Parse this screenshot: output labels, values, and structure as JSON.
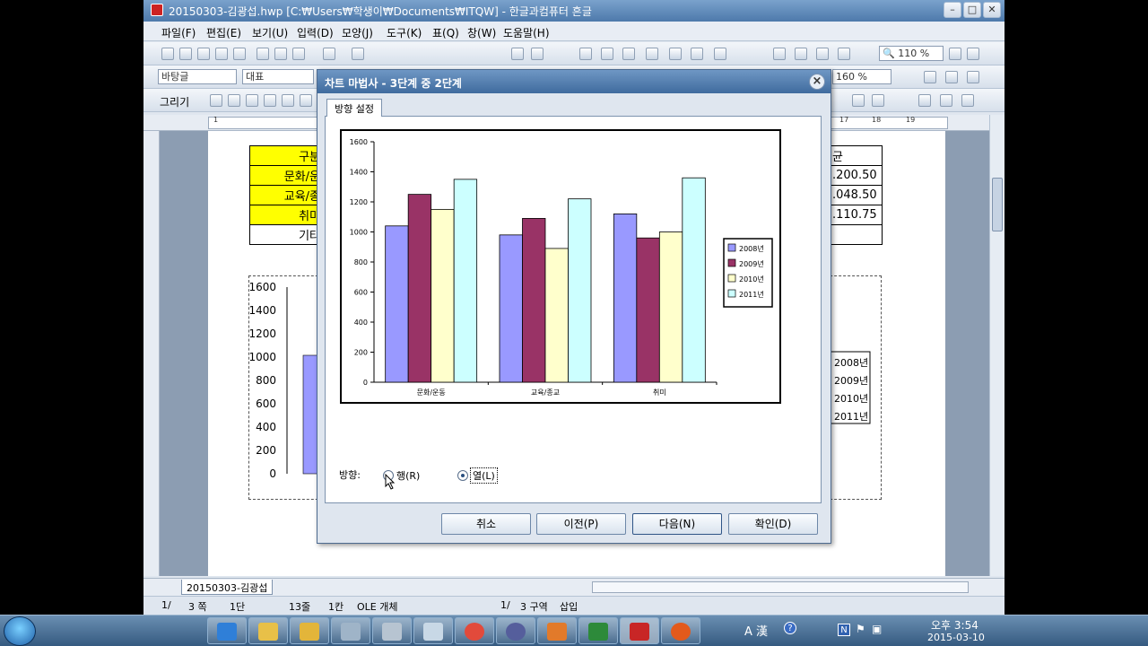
{
  "window": {
    "title": "20150303-김광섭.hwp [C:₩Users₩학생이₩Documents₩ITQW] - 한글과컴퓨터 흔글"
  },
  "menu": [
    "파일(F)",
    "편집(E)",
    "보기(U)",
    "입력(D)",
    "모양(J)",
    "도구(K)",
    "표(Q)",
    "창(W)",
    "도움말(H)"
  ],
  "toolbar": {
    "zoom": "110 %",
    "style": "바탕글",
    "font_group": "대표",
    "zoom2": "160 %",
    "draw_label": "그리기"
  },
  "ruler_numbers": [
    "1",
    "17",
    "18",
    "19"
  ],
  "doc": {
    "left_table": [
      "구분",
      "문화/운",
      "교육/종",
      "취미",
      "기타"
    ],
    "right_table": [
      "균",
      ".200.50",
      ".048.50",
      ".110.75"
    ],
    "chart_y_ticks": [
      "1600",
      "1400",
      "1200",
      "1000",
      "800",
      "600",
      "400",
      "200",
      "0"
    ],
    "chart_legend": [
      "2008년",
      "2009년",
      "2010년",
      "2011년"
    ]
  },
  "doc_tab": "20150303-김광섭",
  "status": {
    "page": "1/",
    "sheet": "3 쪽",
    "col": "1단",
    "line": "13줄",
    "char": "1칸",
    "object": "OLE 개체",
    "sec_page": "1/",
    "section": "3 구역",
    "insert": "삽입"
  },
  "dialog": {
    "title": "차트 마법사 - 3단계 중 2단계",
    "tab": "방향 설정",
    "direction_label": "방향:",
    "radio_row": "행(R)",
    "radio_col": "열(L)",
    "buttons": {
      "cancel": "취소",
      "prev": "이전(P)",
      "next": "다음(N)",
      "ok": "확인(D)"
    }
  },
  "tray": {
    "ime": "A 漢",
    "time": "오후 3:54",
    "date": "2015-03-10",
    "n_badge": "N"
  },
  "colors": {
    "series": [
      "#9999ff",
      "#993366",
      "#ffffcc",
      "#ccffff"
    ],
    "title_bar": "#4d79ab",
    "cell_highlight": "#ffff00"
  },
  "chart_data": {
    "type": "bar",
    "categories": [
      "문화/운동",
      "교육/종교",
      "취미"
    ],
    "series": [
      {
        "name": "2008년",
        "values": [
          1040,
          980,
          1120
        ]
      },
      {
        "name": "2009년",
        "values": [
          1250,
          1090,
          960
        ]
      },
      {
        "name": "2010년",
        "values": [
          1150,
          890,
          1000
        ]
      },
      {
        "name": "2011년",
        "values": [
          1350,
          1220,
          1360
        ]
      }
    ],
    "yticks": [
      "1600",
      "1400",
      "1200",
      "1000",
      "800",
      "600",
      "400",
      "200",
      "0"
    ],
    "ylim": [
      0,
      1600
    ],
    "legend": "right",
    "grid": false
  }
}
